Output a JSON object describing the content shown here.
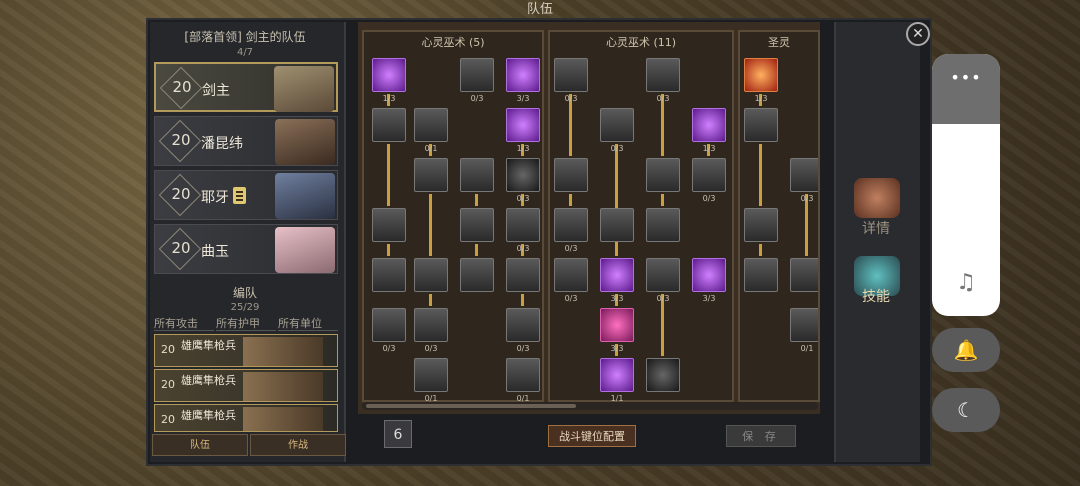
{
  "title": "队伍",
  "leader": {
    "title": "[部落首领] 剑主的队伍",
    "count": "4/7"
  },
  "heroes": [
    {
      "level": "20",
      "name": "剑主"
    },
    {
      "level": "20",
      "name": "潘昆纬"
    },
    {
      "level": "20",
      "name": "耶牙"
    },
    {
      "level": "20",
      "name": "曲玉"
    }
  ],
  "formation": {
    "title": "编队",
    "count": "25/29",
    "filters": [
      "所有攻击",
      "所有护甲",
      "所有单位"
    ]
  },
  "units": [
    {
      "level": "20",
      "name": "雄鹰隼枪兵"
    },
    {
      "level": "20",
      "name": "雄鹰隼枪兵"
    },
    {
      "level": "20",
      "name": "雄鹰隼枪兵"
    }
  ],
  "bottom_tabs": [
    "队伍",
    "作战"
  ],
  "trees": [
    {
      "title": "心灵巫术 (5)"
    },
    {
      "title": "心灵巫术 (11)"
    },
    {
      "title": "圣灵"
    }
  ],
  "nodes": {
    "t1": [
      "1/3",
      "0/3",
      "3/3",
      "",
      "0/1",
      "1/3",
      "",
      "",
      "0/3",
      "",
      "",
      "0/3",
      "",
      "",
      "",
      "",
      "0/3",
      "0/3",
      "0/3",
      "0/1",
      "0/1"
    ],
    "t2": [
      "0/3",
      "0/3",
      "",
      "0/3",
      "1/3",
      "",
      "0/3",
      "0/3",
      "",
      "",
      "0/3",
      "3/3",
      "0/3",
      "3/3",
      "3/3",
      "1/1",
      ""
    ],
    "t3": [
      "1/3",
      "",
      "0/3",
      "",
      "",
      "",
      "0/1"
    ]
  },
  "points": "6",
  "battle_btn": "战斗键位配置",
  "save_btn": "保 存",
  "side": {
    "details": "详情",
    "skills": "技能"
  },
  "right_panel": {
    "dots": "•••",
    "note": "♫",
    "bell": "🔔",
    "moon": "☾"
  },
  "colors": {
    "accent": "#b49a5a",
    "skill_arrow": "#c8a040"
  }
}
